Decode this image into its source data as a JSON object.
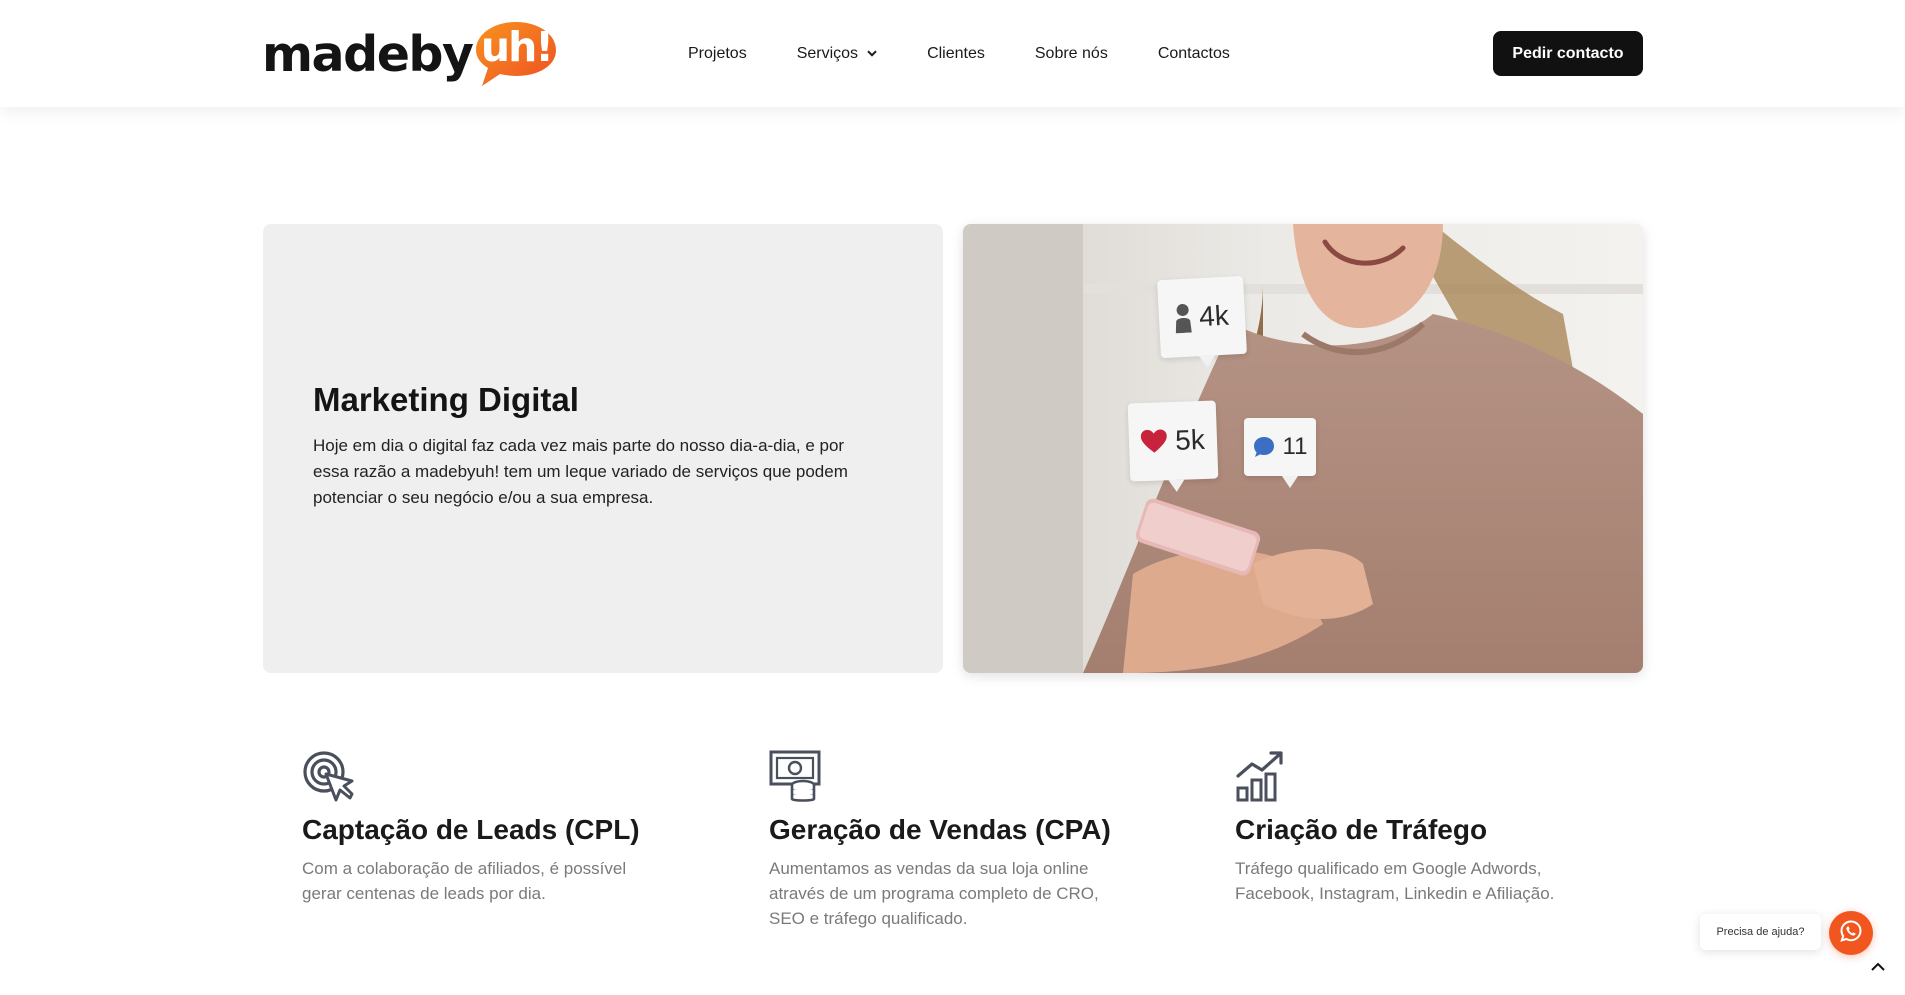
{
  "header": {
    "logo": {
      "text": "madeby",
      "bubble_text": "uh!",
      "bubble_color": "#f26b1d"
    },
    "nav": [
      {
        "label": "Projetos"
      },
      {
        "label": "Serviços",
        "has_dropdown": true
      },
      {
        "label": "Clientes"
      },
      {
        "label": "Sobre nós"
      },
      {
        "label": "Contactos"
      }
    ],
    "cta_label": "Pedir contacto"
  },
  "intro": {
    "title": "Marketing Digital",
    "text": "Hoje em dia o digital faz cada vez mais parte do nosso dia-a-dia, e por essa razão a madebyuh! tem um leque variado de serviços que podem potenciar o seu negócio e/ou a sua empresa."
  },
  "photo": {
    "badges": [
      {
        "icon": "user-icon",
        "value": "4k"
      },
      {
        "icon": "heart-icon",
        "value": "5k",
        "color": "#c8233c"
      },
      {
        "icon": "comment-icon",
        "value": "11",
        "color": "#3b6fc4"
      }
    ]
  },
  "services": [
    {
      "icon": "target-cursor-icon",
      "title": "Captação de Leads (CPL)",
      "description": "Com a colaboração de afiliados, é possível gerar centenas de leads por dia."
    },
    {
      "icon": "money-coins-icon",
      "title": "Geração de Vendas (CPA)",
      "description": "Aumentamos as vendas da sua loja online através de um programa completo de CRO, SEO e tráfego qualificado."
    },
    {
      "icon": "bar-chart-growth-icon",
      "title": "Criação de Tráfego",
      "description": "Tráfego qualificado em Google Adwords, Facebook, Instagram, Linkedin e Afiliação."
    }
  ],
  "widgets": {
    "help_label": "Precisa de ajuda?",
    "whatsapp_color": "#f0561e"
  },
  "colors": {
    "accent": "#f26b1d",
    "dark": "#111111",
    "muted_text": "#7a7a7a",
    "card_bg": "#efefef"
  }
}
